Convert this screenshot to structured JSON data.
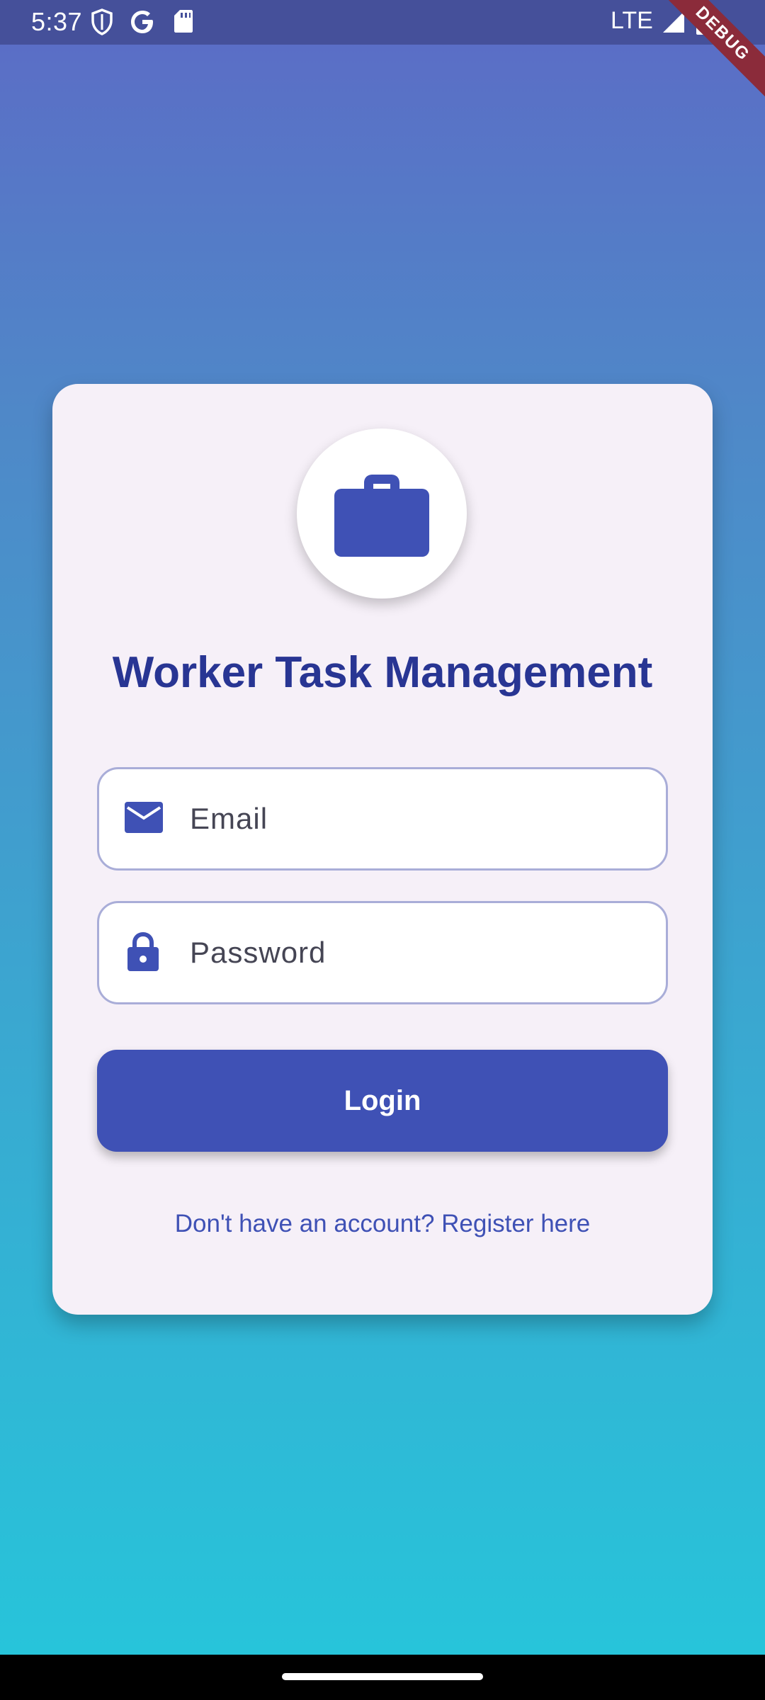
{
  "status_bar": {
    "time": "5:37",
    "network": "LTE",
    "icons": [
      "shield-icon",
      "google-icon",
      "sd-card-icon",
      "signal-icon",
      "battery-icon"
    ]
  },
  "debug_banner": "DEBUG",
  "login_card": {
    "logo_icon": "briefcase-icon",
    "title": "Worker Task Management",
    "email_field": {
      "placeholder": "Email",
      "icon": "email-icon"
    },
    "password_field": {
      "placeholder": "Password",
      "icon": "lock-icon"
    },
    "login_button": "Login",
    "register_link": "Don't have an account? Register here"
  },
  "colors": {
    "primary": "#3f51b5",
    "title": "#283593",
    "card_background": "#f6f0f8",
    "gradient_top": "#5c6bc6",
    "gradient_bottom": "#27c4da"
  }
}
